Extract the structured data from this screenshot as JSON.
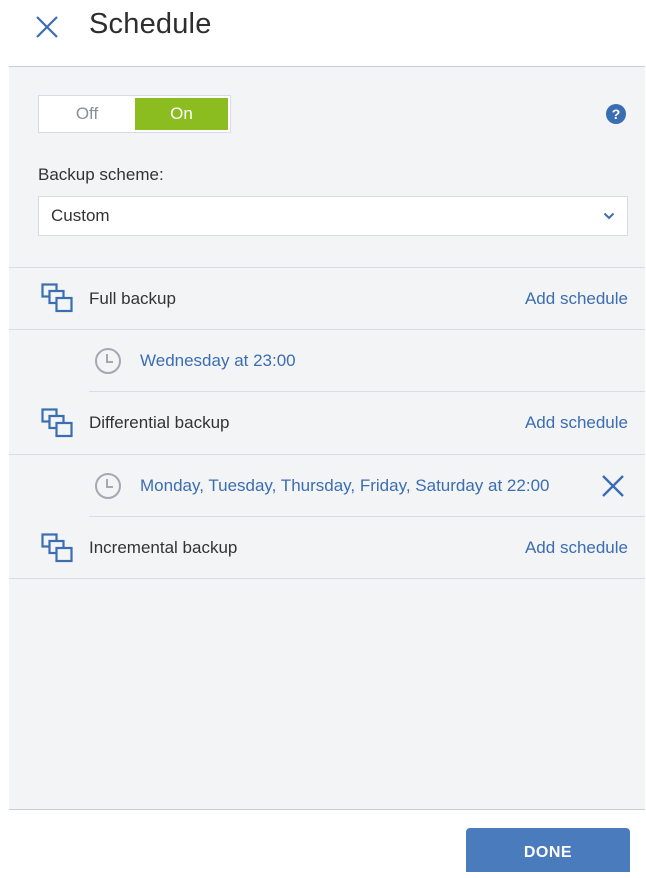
{
  "header": {
    "title": "Schedule"
  },
  "toggle": {
    "off_label": "Off",
    "on_label": "On",
    "state": "On"
  },
  "help": {
    "label": "?"
  },
  "scheme": {
    "label": "Backup scheme:",
    "value": "Custom"
  },
  "backups": [
    {
      "title": "Full backup",
      "action": "Add schedule",
      "schedule": "Wednesday at 23:00"
    },
    {
      "title": "Differential backup",
      "action": "Add schedule",
      "schedule": "Monday, Tuesday, Thursday, Friday, Saturday at 22:00"
    },
    {
      "title": "Incremental backup",
      "action": "Add schedule"
    }
  ],
  "footer": {
    "done_label": "DONE"
  },
  "colors": {
    "accent": "#3b6db2",
    "toggle_on": "#8cbd20",
    "panel_bg": "#f3f4f6",
    "button": "#4a7bbd"
  }
}
